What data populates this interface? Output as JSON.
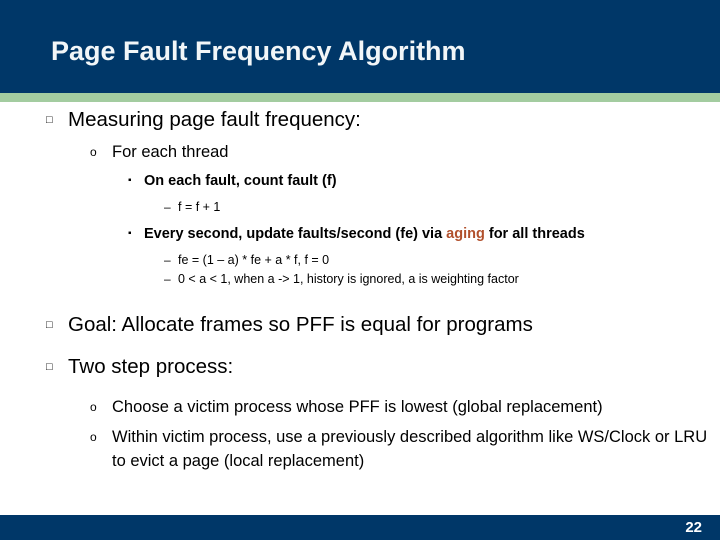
{
  "slide": {
    "title": "Page Fault Frequency Algorithm",
    "page_number": "22",
    "colors": {
      "title_band": "#003768",
      "accent_band": "#a3cca0",
      "footer_band": "#003768",
      "title_text": "#f2f6f8",
      "body_text": "#000000",
      "highlight": "#b1502c"
    },
    "bullet_glyphs": {
      "level1": "□",
      "level2": "o",
      "level3": "▪",
      "level4": "–"
    },
    "content": [
      {
        "level": 1,
        "name": "bullet-measuring-page-fault-frequency",
        "text": "Measuring page fault frequency:"
      },
      {
        "level": 2,
        "name": "bullet-for-each-thread",
        "text": "For each thread"
      },
      {
        "level": 3,
        "name": "bullet-on-each-fault",
        "text": "On each fault, count fault (f)"
      },
      {
        "level": 4,
        "name": "bullet-f-equals-f-plus-1",
        "text": "f = f + 1"
      },
      {
        "level": 3,
        "name": "bullet-every-second-update",
        "text_before": "Every second, update faults/second (fe) via ",
        "highlight": "aging",
        "text_after": " for all threads"
      },
      {
        "level": 4,
        "name": "bullet-fe-formula",
        "text": "fe = (1 – a) * fe + a * f, f = 0"
      },
      {
        "level": 4,
        "name": "bullet-a-range",
        "text": "0 < a < 1, when a -> 1, history is ignored, a is weighting factor"
      },
      {
        "level": 1,
        "name": "bullet-goal",
        "text": "Goal: Allocate frames so PFF is equal for programs"
      },
      {
        "level": 1,
        "name": "bullet-two-step-process",
        "text": "Two step process:"
      },
      {
        "level": 2,
        "name": "bullet-choose-victim-process",
        "text": "Choose a victim process whose PFF is lowest (global replacement)"
      },
      {
        "level": 2,
        "name": "bullet-within-victim-process",
        "text": "Within victim process, use a previously described algorithm like WS/Clock or LRU to evict a page (local replacement)"
      }
    ]
  }
}
